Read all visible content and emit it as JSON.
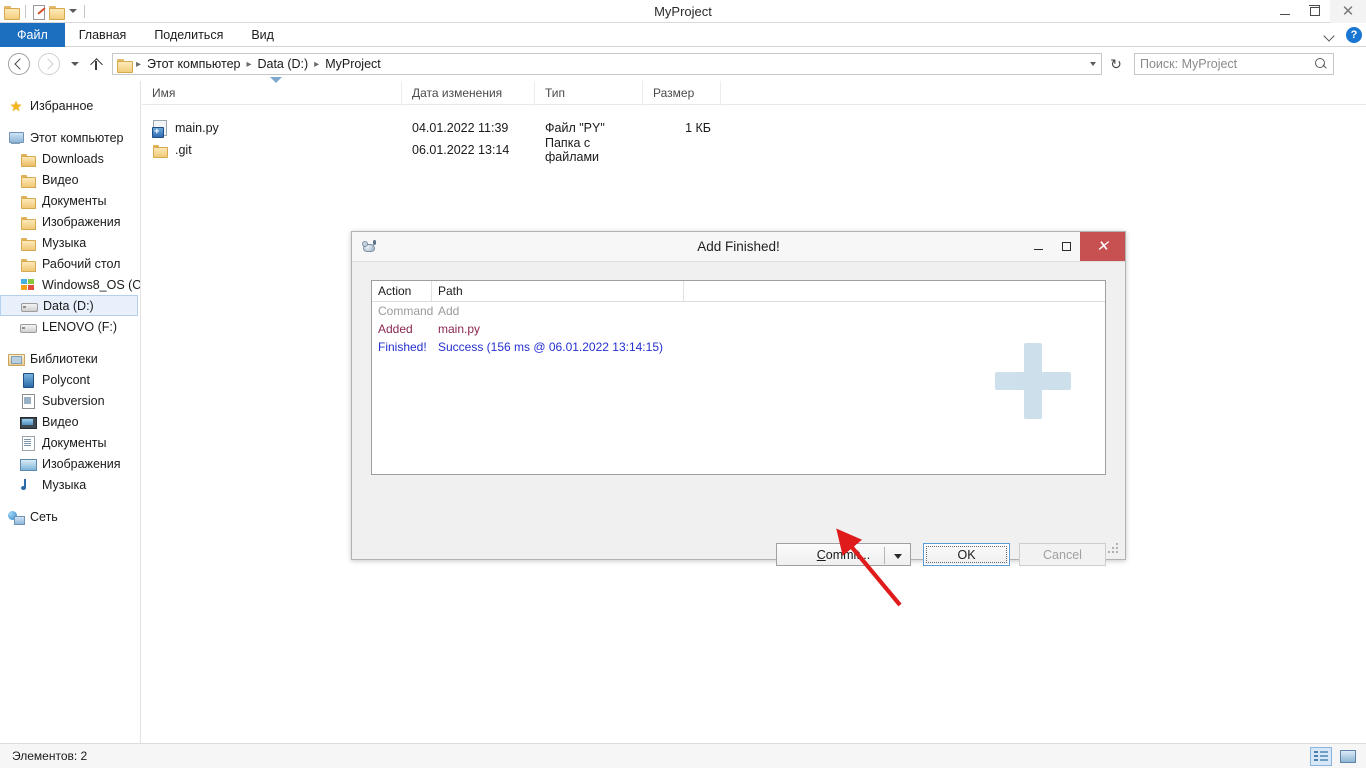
{
  "window": {
    "title": "MyProject",
    "minimize_label": "Свернуть",
    "maximize_label": "Развернуть",
    "close_label": "Закрыть"
  },
  "quick_access": [
    {
      "name": "folder-icon",
      "label": "Свойства"
    },
    {
      "name": "new-folder-icon",
      "label": "Создать папку"
    },
    {
      "name": "folder-icon",
      "label": "Папка"
    },
    {
      "name": "chevron-down-icon",
      "label": "Настроить панель быстрого доступа"
    }
  ],
  "ribbon": {
    "tabs": [
      {
        "label": "Файл",
        "active": true
      },
      {
        "label": "Главная",
        "active": false
      },
      {
        "label": "Поделиться",
        "active": false
      },
      {
        "label": "Вид",
        "active": false
      }
    ],
    "collapse_label": "Свернуть ленту",
    "help_label": "?"
  },
  "address": {
    "back_label": "Назад",
    "forward_label": "Вперёд",
    "recent_label": "Последние расположения",
    "up_label": "Вверх",
    "breadcrumbs": [
      "Этот компьютер",
      "Data (D:)",
      "MyProject"
    ],
    "separator": "▸",
    "refresh_label": "↻"
  },
  "search": {
    "placeholder": "Поиск: MyProject",
    "value": "",
    "icon": "search-icon"
  },
  "nav_pane": {
    "groups": [
      {
        "header": {
          "label": "Избранное",
          "icon": "star-icon",
          "level": 0
        },
        "items": []
      },
      {
        "header": {
          "label": "Этот компьютер",
          "icon": "computer-icon",
          "level": 0
        },
        "items": [
          {
            "label": "Downloads",
            "icon": "downloads-folder-icon"
          },
          {
            "label": "Видео",
            "icon": "video-folder-icon"
          },
          {
            "label": "Документы",
            "icon": "documents-folder-icon"
          },
          {
            "label": "Изображения",
            "icon": "pictures-folder-icon"
          },
          {
            "label": "Музыка",
            "icon": "music-folder-icon"
          },
          {
            "label": "Рабочий стол",
            "icon": "desktop-folder-icon"
          },
          {
            "label": "Windows8_OS (C",
            "icon": "windows-drive-icon"
          },
          {
            "label": "Data (D:)",
            "icon": "drive-icon",
            "selected": true
          },
          {
            "label": "LENOVO (F:)",
            "icon": "drive-icon"
          }
        ]
      },
      {
        "header": {
          "label": "Библиотеки",
          "icon": "library-icon",
          "level": 0
        },
        "items": [
          {
            "label": "Polycont",
            "icon": "polycont-icon"
          },
          {
            "label": "Subversion",
            "icon": "subversion-icon"
          },
          {
            "label": "Видео",
            "icon": "video-library-icon"
          },
          {
            "label": "Документы",
            "icon": "documents-library-icon"
          },
          {
            "label": "Изображения",
            "icon": "pictures-library-icon"
          },
          {
            "label": "Музыка",
            "icon": "music-library-icon"
          }
        ]
      },
      {
        "header": {
          "label": "Сеть",
          "icon": "network-icon",
          "level": 0
        },
        "items": []
      }
    ]
  },
  "file_list": {
    "columns": [
      {
        "label": "Имя",
        "key": "name",
        "sorted": true
      },
      {
        "label": "Дата изменения",
        "key": "date"
      },
      {
        "label": "Тип",
        "key": "type"
      },
      {
        "label": "Размер",
        "key": "size"
      }
    ],
    "rows": [
      {
        "name": "main.py",
        "icon": "python-file-icon",
        "date": "04.01.2022 11:39",
        "type": "Файл \"PY\"",
        "size": "1 КБ"
      },
      {
        "name": ".git",
        "icon": "folder-icon",
        "date": "06.01.2022 13:14",
        "type": "Папка с файлами",
        "size": ""
      }
    ]
  },
  "status_bar": {
    "item_count": "Элементов: 2",
    "view_details_label": "Таблица",
    "view_large_label": "Крупные значки"
  },
  "dialog": {
    "title": "Add Finished!",
    "icon": "tortoise-git-icon",
    "minimize_label": "Свернуть",
    "maximize_label": "Развернуть",
    "close_label": "Закрыть",
    "log": {
      "columns": [
        {
          "label": "Action"
        },
        {
          "label": "Path"
        },
        {
          "label": ""
        }
      ],
      "rows": [
        {
          "action": "Command",
          "path": "Add",
          "color": "#9a9a9a"
        },
        {
          "action": "Added",
          "path": "main.py",
          "color": "#8a2752"
        },
        {
          "action": "Finished!",
          "path": "Success (156 ms @ 06.01.2022 13:14:15)",
          "color": "#2430d0"
        }
      ]
    },
    "watermark_icon": "plus-watermark-icon",
    "buttons": {
      "commit": {
        "label": "Commit...",
        "accelerator": "C",
        "enabled": true
      },
      "commit_dropdown": {
        "label": "▼",
        "enabled": true
      },
      "ok": {
        "label": "OK",
        "enabled": true,
        "focused": true
      },
      "cancel": {
        "label": "Cancel",
        "enabled": false
      }
    }
  },
  "annotation": {
    "arrow_color": "#e01b1b",
    "name": "pointer-arrow"
  },
  "colors": {
    "accent": "#1c6fbe",
    "selection": "#e8f0fb",
    "dialog_close": "#c75050",
    "log_gray": "#9a9a9a",
    "log_purple": "#8a2752",
    "log_blue": "#2430d0",
    "watermark": "#c3d9e6"
  }
}
